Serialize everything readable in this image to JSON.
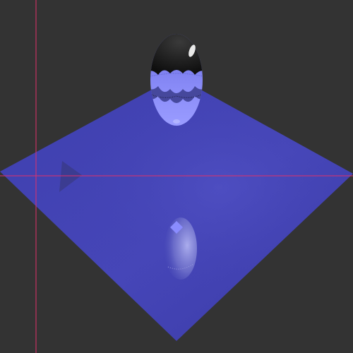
{
  "viewport": {
    "background_color": "#333333",
    "axis_line_color": "#e0306a"
  },
  "scene": {
    "ground_plane": {
      "shape": "diamond-plane",
      "color": "#4040b0"
    },
    "egg_object": {
      "shape": "ellipsoid",
      "top_color": "#1a1a1a",
      "bottom_color": "#7a7cf0",
      "pattern": "scalloped-wave-band"
    },
    "reflection": {
      "shape": "ellipsoid-reflection",
      "color": "#8c8ee0",
      "highlight_color": "#8888ff"
    },
    "shadow": {
      "shape": "triangle-shadow",
      "color": "#3a3a7a"
    }
  }
}
